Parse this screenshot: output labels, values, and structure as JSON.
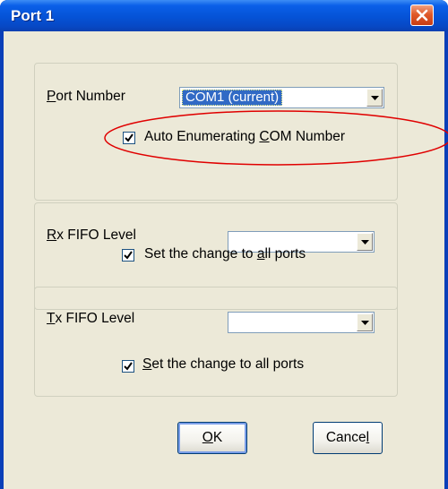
{
  "window": {
    "title": "Port 1",
    "close_icon": "close-x-icon",
    "accent_color": "#0a5fe8",
    "close_color": "#d9531e"
  },
  "port_group": {
    "label_accel": "P",
    "label_rest": "ort Number",
    "combo_value": "COM1 (current)",
    "auto_enum_pre": "Auto Enumerating ",
    "auto_enum_accel": "C",
    "auto_enum_post": "OM Number",
    "auto_enum_checked": true,
    "highlight_color": "#e00000"
  },
  "rx_group": {
    "label_accel": "R",
    "label_rest": "x FIFO Level",
    "combo_value": "",
    "apply_pre": "Set the change to ",
    "apply_accel": "a",
    "apply_post": "ll ports",
    "apply_checked": true
  },
  "tx_group": {
    "label_accel": "T",
    "label_rest": "x FIFO Level",
    "combo_value": "",
    "apply_accel": "S",
    "apply_post": "et the change to all ports",
    "apply_checked": true
  },
  "buttons": {
    "ok_accel": "O",
    "ok_rest": "K",
    "cancel_pre": "Cance",
    "cancel_accel": "l"
  }
}
